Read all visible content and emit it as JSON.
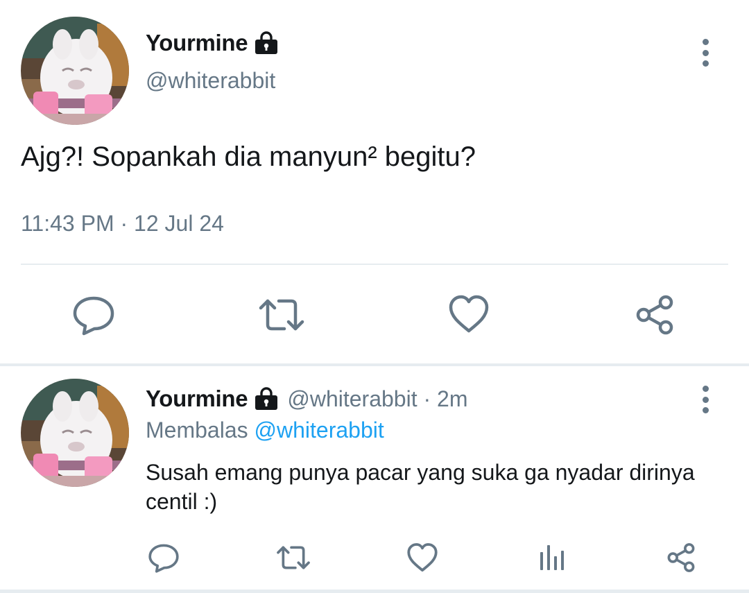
{
  "main_tweet": {
    "display_name": "Yourmine",
    "lock_icon": "lock-icon",
    "handle": "@whiterabbit",
    "text": "Ajg?! Sopankah dia manyun² begitu?",
    "timestamp": "11:43 PM · 12 Jul 24",
    "actions": [
      "reply-icon",
      "retweet-icon",
      "like-icon",
      "share-icon"
    ]
  },
  "reply_tweet": {
    "display_name": "Yourmine",
    "handle_time": "@whiterabbit · 2m",
    "replying_label": "Membalas",
    "replying_mention": "@whiterabbit",
    "text": "Susah emang punya pacar yang suka ga nyadar dirinya centil :)",
    "actions": [
      "reply-icon",
      "retweet-icon",
      "like-icon",
      "analytics-icon",
      "share-icon"
    ]
  },
  "colors": {
    "text_primary": "#14171a",
    "text_secondary": "#657786",
    "link": "#1da1f2",
    "divider": "#e6ecf0"
  }
}
